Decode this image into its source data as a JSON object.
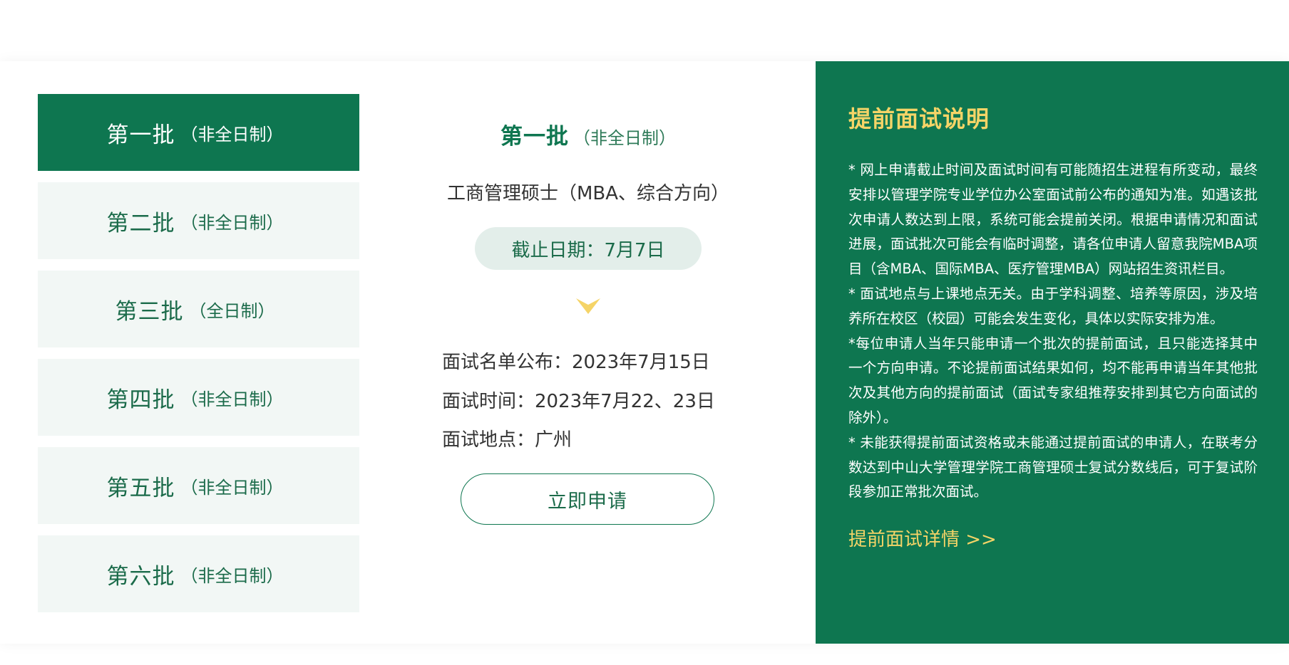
{
  "batches": [
    {
      "name": "第一批",
      "type": "（非全日制）",
      "active": true
    },
    {
      "name": "第二批",
      "type": "（非全日制）",
      "active": false
    },
    {
      "name": "第三批",
      "type": "（全日制）",
      "active": false
    },
    {
      "name": "第四批",
      "type": "（非全日制）",
      "active": false
    },
    {
      "name": "第五批",
      "type": "（非全日制）",
      "active": false
    },
    {
      "name": "第六批",
      "type": "（非全日制）",
      "active": false
    }
  ],
  "detail": {
    "title": "第一批",
    "subtitle": "（非全日制）",
    "program": "工商管理硕士（MBA、综合方向）",
    "deadline": "截止日期：7月7日",
    "list_publish": "面试名单公布：2023年7月15日",
    "interview_time": "面试时间：2023年7月22、23日",
    "interview_location": "面试地点：广州",
    "apply_label": "立即申请"
  },
  "notes": {
    "title": "提前面试说明",
    "paragraphs": [
      "* 网上申请截止时间及面试时间有可能随招生进程有所变动，最终安排以管理学院专业学位办公室面试前公布的通知为准。如遇该批次申请人数达到上限，系统可能会提前关闭。根据申请情况和面试进展，面试批次可能会有临时调整，请各位申请人留意我院MBA项目（含MBA、国际MBA、医疗管理MBA）网站招生资讯栏目。",
      "* 面试地点与上课地点无关。由于学科调整、培养等原因，涉及培养所在校区（校园）可能会发生变化，具体以实际安排为准。",
      "*每位申请人当年只能申请一个批次的提前面试，且只能选择其中一个方向申请。不论提前面试结果如何，均不能再申请当年其他批次及其他方向的提前面试（面试专家组推荐安排到其它方向面试的除外）。",
      "* 未能获得提前面试资格或未能通过提前面试的申请人，在联考分数达到中山大学管理学院工商管理硕士复试分数线后，可于复试阶段参加正常批次面试。"
    ],
    "link_label": "提前面试详情 >>"
  },
  "colors": {
    "primary": "#0e7650",
    "accent": "#f5d467",
    "tab_bg": "#f2f7f5",
    "deadline_bg": "#e3eeea"
  },
  "icons": {
    "arrow": "chevron-down-icon"
  }
}
